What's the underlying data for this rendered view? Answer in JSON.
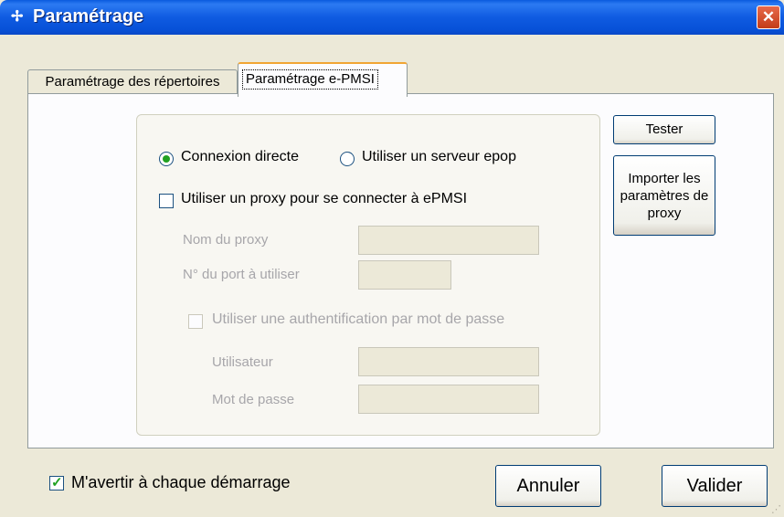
{
  "window": {
    "title": "Paramétrage",
    "close_symbol": "✕",
    "app_icon_glyph": "✢"
  },
  "tabs": [
    {
      "label": "Paramétrage des répertoires",
      "active": false
    },
    {
      "label": "Paramétrage e-PMSI",
      "active": true
    }
  ],
  "connection": {
    "radio_direct": {
      "label": "Connexion directe",
      "selected": true
    },
    "radio_epop": {
      "label": "Utiliser un serveur epop",
      "selected": false
    },
    "proxy_checkbox": {
      "label": "Utiliser un proxy pour se connecter à ePMSI",
      "checked": false
    },
    "proxy_name_label": "Nom du proxy",
    "proxy_name_value": "",
    "proxy_port_label": "N° du port à utiliser",
    "proxy_port_value": "",
    "auth_checkbox": {
      "label": "Utiliser une authentification par mot de passe",
      "checked": false,
      "enabled": false
    },
    "user_label": "Utilisateur",
    "user_value": "",
    "password_label": "Mot de passe",
    "password_value": ""
  },
  "buttons": {
    "tester_label": "Tester",
    "import_label": "Importer les paramètres de proxy",
    "cancel_label": "Annuler",
    "ok_label": "Valider"
  },
  "footer": {
    "notify_checkbox": {
      "label": "M'avertir à chaque démarrage",
      "checked": true
    }
  },
  "colors": {
    "titlebar": "#0A5BDE",
    "active_tab_accent": "#F1A533",
    "check_green": "#21A121",
    "window_bg": "#ECE9D8"
  }
}
